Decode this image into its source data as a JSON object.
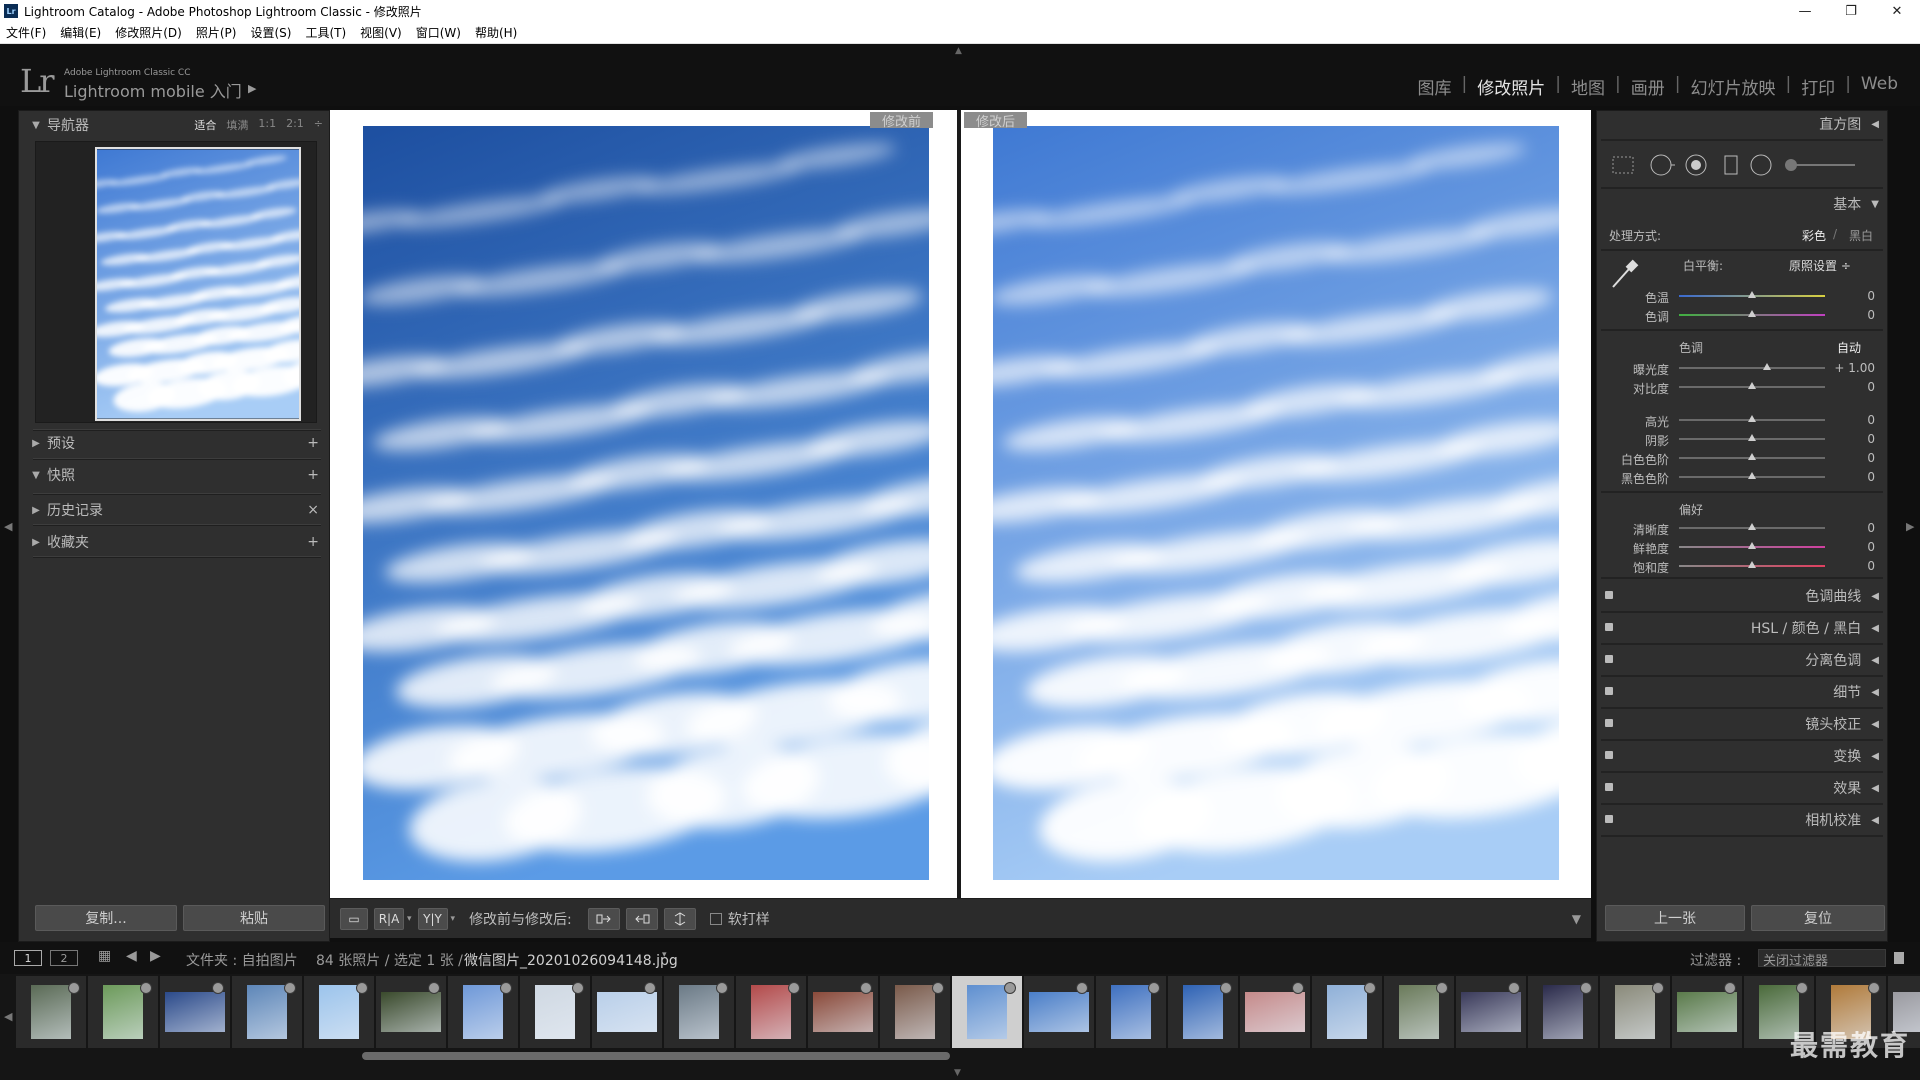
{
  "window": {
    "icon_label": "Lr",
    "title": "Lightroom Catalog - Adobe Photoshop Lightroom Classic - 修改照片",
    "controls": [
      "—",
      "❐",
      "✕"
    ]
  },
  "menu": [
    "文件(F)",
    "编辑(E)",
    "修改照片(D)",
    "照片(P)",
    "设置(S)",
    "工具(T)",
    "视图(V)",
    "窗口(W)",
    "帮助(H)"
  ],
  "identity": {
    "logo": "Lr",
    "small": "Adobe Lightroom Classic CC",
    "big": "Lightroom mobile 入门",
    "arrow": "▶"
  },
  "modules": [
    "图库",
    "修改照片",
    "地图",
    "画册",
    "幻灯片放映",
    "打印",
    "Web"
  ],
  "modules_separator": "|",
  "active_module": "修改照片",
  "left_panel": {
    "navigator": {
      "title": "导航器",
      "options": [
        "适合",
        "填满",
        "1:1",
        "2:1"
      ],
      "active": "适合"
    },
    "sections": [
      {
        "title": "预设",
        "icon": "+"
      },
      {
        "title": "快照",
        "icon": "+"
      },
      {
        "title": "历史记录",
        "icon": "×"
      },
      {
        "title": "收藏夹",
        "icon": "+"
      }
    ],
    "copy_button": "复制...",
    "paste_button": "粘贴"
  },
  "compare": {
    "before_label": "修改前",
    "after_label": "修改后"
  },
  "toolbar": {
    "view_buttons": [
      "▭",
      "R|A",
      "Y|Y"
    ],
    "compare_label": "修改前与修改后:",
    "soft_proof": "软打样"
  },
  "right_panel": {
    "histogram": "直方图",
    "basic": "基本",
    "treatment_label": "处理方式:",
    "treatment_color": "彩色",
    "treatment_bw": "黑白",
    "wb_label": "白平衡:",
    "wb_value": "原照设置 ÷",
    "wb_sliders": [
      {
        "name": "色温",
        "value": "0",
        "pos": 0.5
      },
      {
        "name": "色调",
        "value": "0",
        "pos": 0.5
      }
    ],
    "tone_label": "色调",
    "auto_label": "自动",
    "tone_sliders": [
      {
        "name": "曝光度",
        "value": "+ 1.00",
        "pos": 0.6
      },
      {
        "name": "对比度",
        "value": "0",
        "pos": 0.5
      }
    ],
    "tone_sliders2": [
      {
        "name": "高光",
        "value": "0",
        "pos": 0.5
      },
      {
        "name": "阴影",
        "value": "0",
        "pos": 0.5
      },
      {
        "name": "白色色阶",
        "value": "0",
        "pos": 0.5
      },
      {
        "name": "黑色色阶",
        "value": "0",
        "pos": 0.5
      }
    ],
    "presence_label": "偏好",
    "presence_sliders": [
      {
        "name": "清晰度",
        "value": "0",
        "pos": 0.5
      },
      {
        "name": "鲜艳度",
        "value": "0",
        "pos": 0.5
      },
      {
        "name": "饱和度",
        "value": "0",
        "pos": 0.5
      }
    ],
    "collapsed_sections": [
      "色调曲线",
      "HSL / 颜色 / 黑白",
      "分离色调",
      "细节",
      "镜头校正",
      "变换",
      "效果",
      "相机校准"
    ],
    "prev_button": "上一张",
    "reset_button": "复位"
  },
  "filmstrip": {
    "pages": [
      "1",
      "2"
    ],
    "source": "文件夹 : 自拍图片",
    "count": "84 张照片 / 选定 1 张 /",
    "filename": "微信图片_20201026094148.jpg",
    "filter_label": "过滤器 :",
    "filter_value": "关闭过滤器",
    "selected_index": 13,
    "thumb_colors": [
      "#5a6a55",
      "#6c9a5a",
      "#2b4a8a",
      "#5d86b8",
      "#9cc4ec",
      "#3a4a2c",
      "#6e98d8",
      "#cfd8e2",
      "#b9cfe9",
      "#6b7a86",
      "#b34a4a",
      "#8a4a3a",
      "#7a5a4a",
      "#5e8fd0",
      "#4a7ec8",
      "#3e70c0",
      "#2e62b4",
      "#c58a8a",
      "#8fb0d8",
      "#6a7a5a",
      "#3a3a5a",
      "#2a2a4a",
      "#8a8a7a",
      "#5a7a4a",
      "#4a6a3a",
      "#b07a3a",
      "#9a9aa0"
    ]
  },
  "watermark": "最需教育"
}
